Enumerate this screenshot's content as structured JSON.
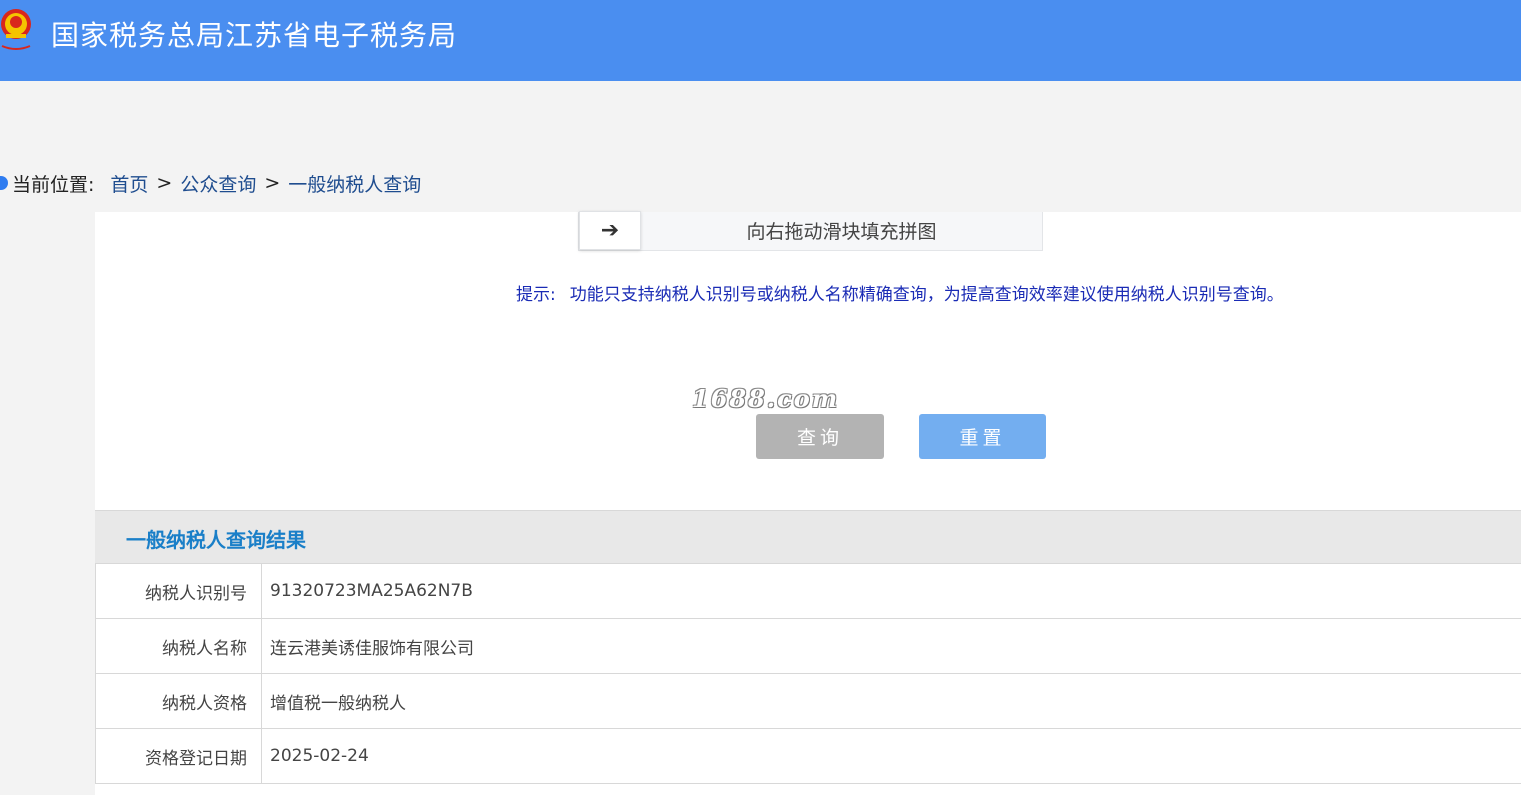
{
  "header": {
    "title": "国家税务总局江苏省电子税务局",
    "logo_icon": "tax-emblem-icon",
    "bg_color": "#4a8ef0"
  },
  "breadcrumb": {
    "prefix": "当前位置:",
    "items": [
      "首页",
      "公众查询",
      "一般纳税人查询"
    ],
    "separator": ">"
  },
  "slider": {
    "handle_icon": "arrow-right-icon",
    "handle_glyph": "➔",
    "text": "向右拖动滑块填充拼图"
  },
  "tip": {
    "label": "提示:",
    "text": "功能只支持纳税人识别号或纳税人名称精确查询，为提高查询效率建议使用纳税人识别号查询。"
  },
  "watermark": "1688.com",
  "buttons": {
    "query": "查询",
    "reset": "重置"
  },
  "result": {
    "title": "一般纳税人查询结果",
    "rows": [
      {
        "label": "纳税人识别号",
        "value": "91320723MA25A62N7B"
      },
      {
        "label": "纳税人名称",
        "value": "连云港美诱佳服饰有限公司"
      },
      {
        "label": "纳税人资格",
        "value": "增值税一般纳税人"
      },
      {
        "label": "资格登记日期",
        "value": "2025-02-24"
      }
    ]
  }
}
